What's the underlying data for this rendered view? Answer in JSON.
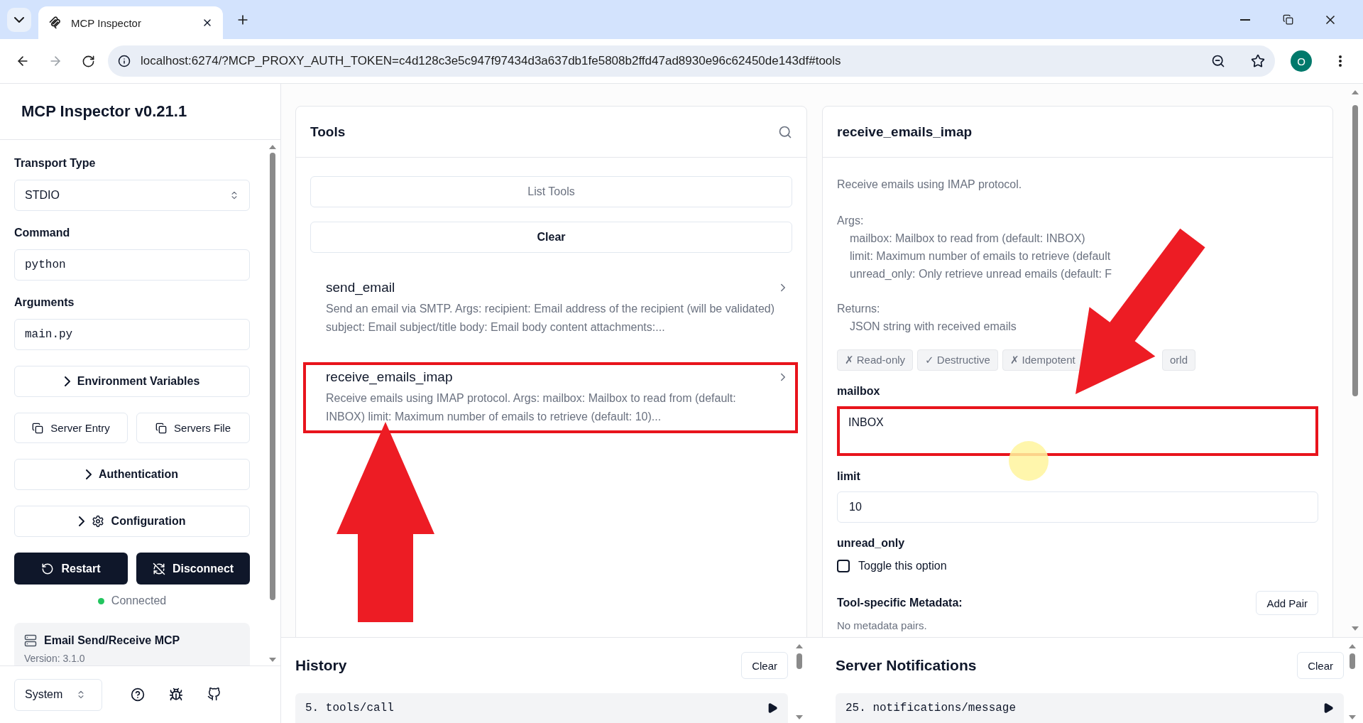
{
  "browser": {
    "tab_title": "MCP Inspector",
    "url": "localhost:6274/?MCP_PROXY_AUTH_TOKEN=c4d128c3e5c947f97434d3a637db1fe5808b2ffd47ad8930e96c62450de143df#tools",
    "profile_initial": "O"
  },
  "sidebar": {
    "title": "MCP Inspector v0.21.1",
    "transport": {
      "label": "Transport Type",
      "value": "STDIO"
    },
    "command": {
      "label": "Command",
      "value": "python"
    },
    "arguments": {
      "label": "Arguments",
      "value": "main.py"
    },
    "env_button": "Environment Variables",
    "copy_buttons": [
      "Server Entry",
      "Servers File"
    ],
    "auth_button": "Authentication",
    "config_button": "Configuration",
    "restart_button": "Restart",
    "disconnect_button": "Disconnect",
    "status": {
      "label": "Connected",
      "connected": true
    },
    "server": {
      "name": "Email Send/Receive MCP",
      "version": "Version: 3.1.0"
    },
    "theme": "System"
  },
  "tools": {
    "title": "Tools",
    "list_button": "List Tools",
    "clear_button": "Clear",
    "items": [
      {
        "name": "send_email",
        "description": "Send an email via SMTP. Args: recipient: Email address of the recipient (will be validated) subject: Email subject/title body: Email body content attachments:...",
        "highlighted": false
      },
      {
        "name": "receive_emails_imap",
        "description": "Receive emails using IMAP protocol. Args: mailbox: Mailbox to read from (default: INBOX) limit: Maximum number of emails to retrieve (default: 10)...",
        "highlighted": true
      }
    ]
  },
  "details": {
    "title": "receive_emails_imap",
    "summary": "Receive emails using IMAP protocol.",
    "args_heading": "Args:",
    "args": [
      "mailbox: Mailbox to read from (default: INBOX)",
      "limit: Maximum number of emails to retrieve (default",
      "unread_only: Only retrieve unread emails (default: F"
    ],
    "returns_heading": "Returns:",
    "returns": "JSON string with received emails",
    "badges": [
      "✗ Read-only",
      "✓ Destructive",
      "✗ Idempotent",
      "orld"
    ],
    "fields": [
      {
        "kind": "textarea",
        "label": "mailbox",
        "value": "INBOX",
        "highlighted": true
      },
      {
        "kind": "input",
        "label": "limit",
        "value": "10",
        "highlighted": false
      },
      {
        "kind": "checkbox",
        "label": "unread_only",
        "option": "Toggle this option",
        "checked": false
      }
    ],
    "metadata": {
      "title": "Tool-specific Metadata:",
      "add_button": "Add Pair",
      "empty": "No metadata pairs."
    }
  },
  "history": {
    "title": "History",
    "clear_button": "Clear",
    "entries": [
      "5. tools/call"
    ]
  },
  "notifications": {
    "title": "Server Notifications",
    "clear_button": "Clear",
    "entries": [
      "25. notifications/message"
    ]
  }
}
